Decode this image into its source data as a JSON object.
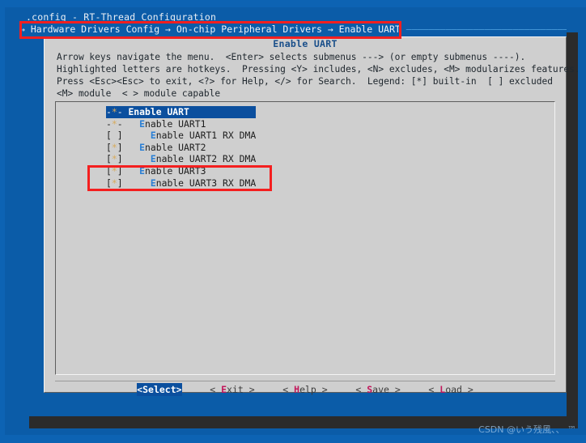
{
  "window": {
    "title": ".config - RT-Thread Configuration",
    "breadcrumb_arrow": "→",
    "breadcrumb": "Hardware Drivers Config → On-chip Peripheral Drivers → Enable UART",
    "breadcrumb_rule": " —————————————————————————————————————————————————————————"
  },
  "dialog": {
    "title": "Enable UART",
    "help_lines": [
      "Arrow keys navigate the menu.  <Enter> selects submenus ---> (or empty submenus ----).",
      "Highlighted letters are hotkeys.  Pressing <Y> includes, <N> excludes, <M> modularizes features.",
      "Press <Esc><Esc> to exit, <?> for Help, </> for Search.  Legend: [*] built-in  [ ] excluded",
      "<M> module  < > module capable"
    ]
  },
  "menu": {
    "items": [
      {
        "marker_pre": "-",
        "marker_star": "*",
        "marker_post": "- ",
        "indent": "",
        "hotkey": "E",
        "label_rest": "nable UART",
        "selected": true
      },
      {
        "marker_pre": "-",
        "marker_star": "*",
        "marker_post": "- ",
        "indent": "  ",
        "hotkey": "E",
        "label_rest": "nable UART1",
        "selected": false
      },
      {
        "marker_pre": "[",
        "marker_star": " ",
        "marker_post": "] ",
        "indent": "    ",
        "hotkey": "E",
        "label_rest": "nable UART1 RX DMA",
        "selected": false
      },
      {
        "marker_pre": "[",
        "marker_star": "*",
        "marker_post": "] ",
        "indent": "  ",
        "hotkey": "E",
        "label_rest": "nable UART2",
        "selected": false
      },
      {
        "marker_pre": "[",
        "marker_star": "*",
        "marker_post": "] ",
        "indent": "    ",
        "hotkey": "E",
        "label_rest": "nable UART2 RX DMA",
        "selected": false
      },
      {
        "marker_pre": "[",
        "marker_star": "*",
        "marker_post": "] ",
        "indent": "  ",
        "hotkey": "E",
        "label_rest": "nable UART3",
        "selected": false
      },
      {
        "marker_pre": "[",
        "marker_star": "*",
        "marker_post": "] ",
        "indent": "    ",
        "hotkey": "E",
        "label_rest": "nable UART3 RX DMA",
        "selected": false
      }
    ]
  },
  "buttons": [
    {
      "open": "<",
      "hotkey": "S",
      "rest": "elect",
      "close": ">",
      "selected": true
    },
    {
      "open": "< ",
      "hotkey": "E",
      "rest": "xit",
      "close": " >",
      "selected": false
    },
    {
      "open": "< ",
      "hotkey": "H",
      "rest": "elp",
      "close": " >",
      "selected": false
    },
    {
      "open": "< ",
      "hotkey": "S",
      "rest": "ave",
      "close": " >",
      "selected": false
    },
    {
      "open": "< ",
      "hotkey": "L",
      "rest": "oad",
      "close": " >",
      "selected": false
    }
  ],
  "annotations": [
    {
      "name": "breadcrumb-highlight",
      "color": "#f41f1f"
    },
    {
      "name": "uart3-highlight",
      "color": "#f41f1f"
    }
  ],
  "watermark": "CSDN @いう残風、、 ™"
}
